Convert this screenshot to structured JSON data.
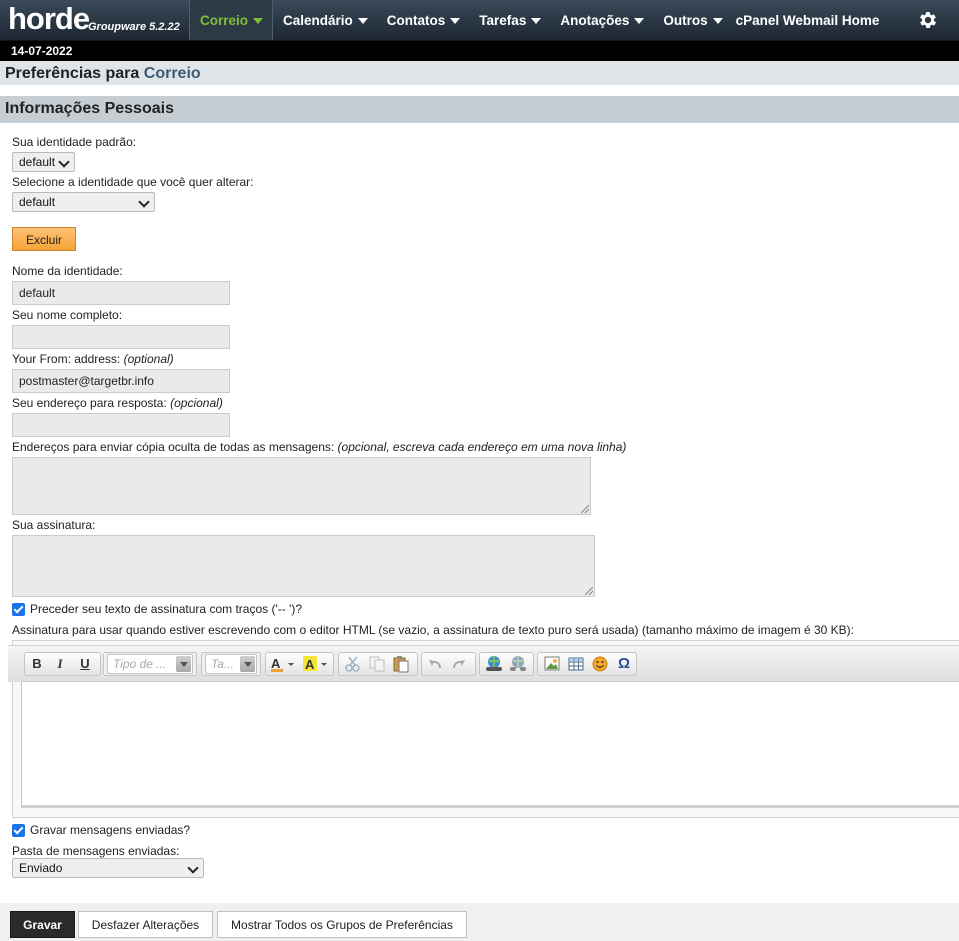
{
  "app": {
    "logo_text": "horde",
    "logo_sub": "Groupware 5.2.22",
    "date": "14-07-2022"
  },
  "nav": [
    {
      "label": "Correio"
    },
    {
      "label": "Calendário"
    },
    {
      "label": "Contatos"
    },
    {
      "label": "Tarefas"
    },
    {
      "label": "Anotações"
    },
    {
      "label": "Outros"
    },
    {
      "label": "cPanel Webmail Home"
    }
  ],
  "header": {
    "prefix": "Preferências para",
    "app_name": "Correio",
    "section": "Informações Pessoais"
  },
  "form": {
    "default_identity_label": "Sua identidade padrão:",
    "default_identity_value": "default",
    "edit_identity_label": "Selecione a identidade que você quer alterar:",
    "edit_identity_value": "default",
    "delete_button": "Excluir",
    "identity_name_label": "Nome da identidade:",
    "identity_name_value": "default",
    "fullname_label": "Seu nome completo:",
    "fullname_value": "",
    "from_label": "Your From: address:",
    "from_optional": "(optional)",
    "from_value": "postmaster@targetbr.info",
    "replyto_label": "Seu endereço para resposta:",
    "replyto_optional": "(opcional)",
    "replyto_value": "",
    "bcc_label": "Endereços para enviar cópia oculta de todas as mensagens:",
    "bcc_hint": "(opcional, escreva cada endereço em uma nova linha)",
    "signature_label": "Sua assinatura:",
    "sig_dashes_label": "Preceder seu texto de assinatura com traços ('-- ')?",
    "sig_dashes_checked": true,
    "html_sig_label": "Assinatura para usar quando estiver escrevendo com o editor HTML (se vazio, a assinatura de texto puro será usada) (tamanho máximo de imagem é 30 KB):",
    "save_sent_label": "Gravar mensagens enviadas?",
    "save_sent_checked": true,
    "sent_folder_label": "Pasta de mensagens enviadas:",
    "sent_folder_value": "Enviado"
  },
  "editor": {
    "bold": "B",
    "italic": "I",
    "underline": "U",
    "font_placeholder": "Tipo de ...",
    "size_placeholder": "Ta...",
    "omega": "Ω"
  },
  "footer": {
    "save": "Gravar",
    "undo": "Desfazer Alterações",
    "show_all": "Mostrar Todos os Grupos de Preferências"
  },
  "colors": {
    "topbar": "#2b3844",
    "active_nav": "#7fbf3a",
    "section_bg": "#c6cdd3",
    "delete_button": "#f7a338"
  }
}
